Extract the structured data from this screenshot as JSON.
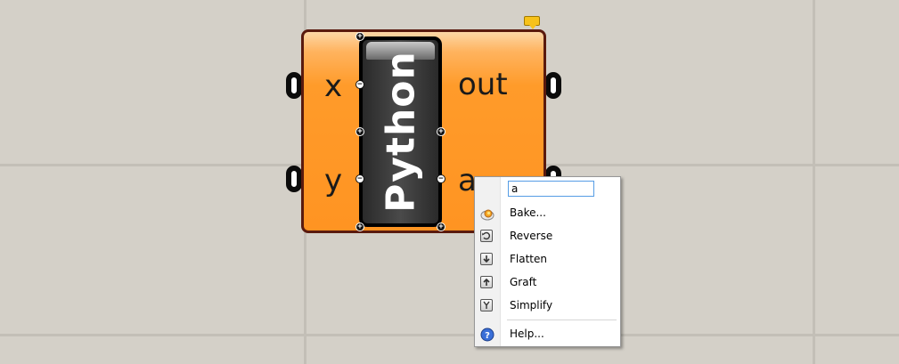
{
  "component": {
    "name": "Python",
    "inputs": [
      "x",
      "y"
    ],
    "outputs": [
      "out",
      "a"
    ]
  },
  "zoomable_ui": {
    "plus": "+",
    "minus": "−"
  },
  "context_menu": {
    "name_value": "a",
    "items": [
      {
        "label": "Bake...",
        "icon": "bake-icon"
      },
      {
        "label": "Reverse",
        "icon": "reverse-icon"
      },
      {
        "label": "Flatten",
        "icon": "flatten-icon"
      },
      {
        "label": "Graft",
        "icon": "graft-icon"
      },
      {
        "label": "Simplify",
        "icon": "simplify-icon"
      },
      {
        "label": "Help...",
        "icon": "help-icon"
      }
    ]
  },
  "colors": {
    "canvas": "#d4d0c8",
    "component_fill": "#ff9422",
    "component_border": "#5a1a0e",
    "name_panel": "#333333",
    "input_focus": "#569de5"
  }
}
